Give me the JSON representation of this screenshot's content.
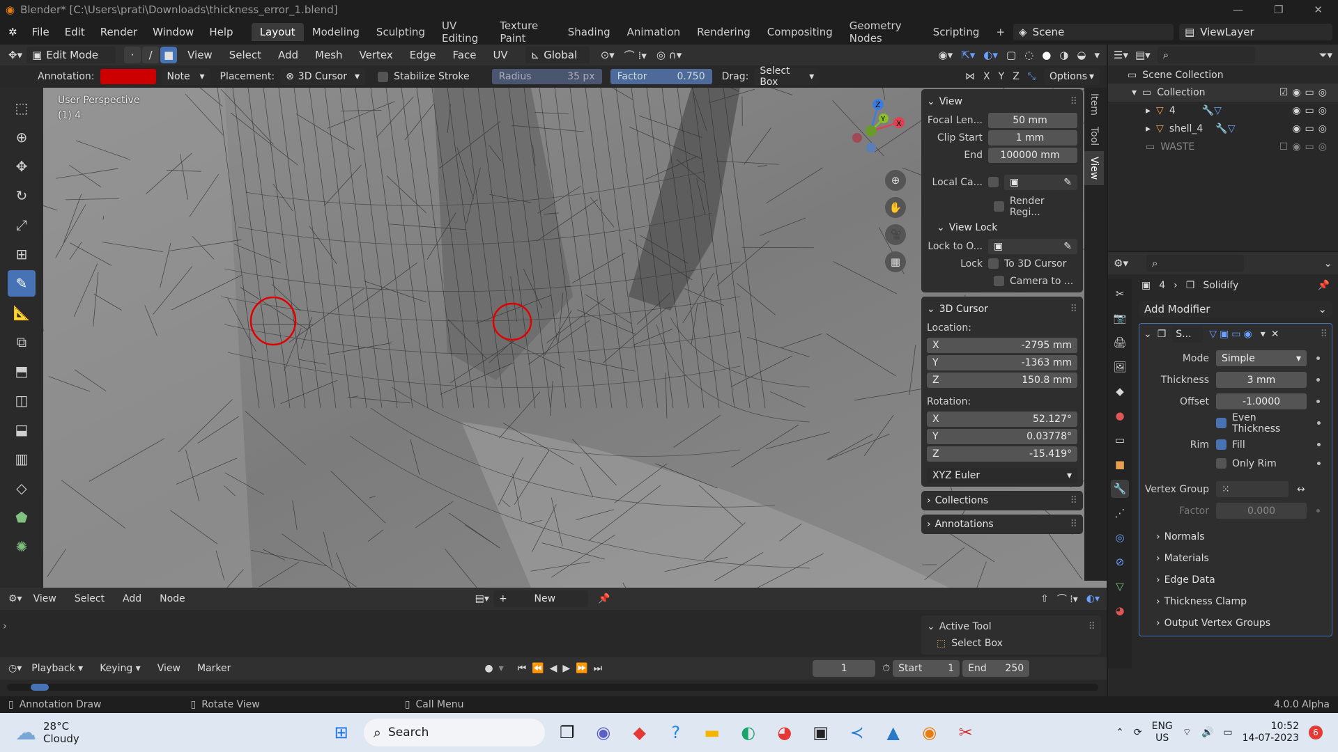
{
  "title": "Blender* [C:\\Users\\prati\\Downloads\\thickness_error_1.blend]",
  "menus": [
    "File",
    "Edit",
    "Render",
    "Window",
    "Help"
  ],
  "workspaces": [
    "Layout",
    "Modeling",
    "Sculpting",
    "UV Editing",
    "Texture Paint",
    "Shading",
    "Animation",
    "Rendering",
    "Compositing",
    "Geometry Nodes",
    "Scripting"
  ],
  "scene": "Scene",
  "view_layer": "ViewLayer",
  "header": {
    "mode": "Edit Mode",
    "menus": [
      "View",
      "Select",
      "Add",
      "Mesh",
      "Vertex",
      "Edge",
      "Face",
      "UV"
    ],
    "orientation": "Global"
  },
  "toolset": {
    "annotation_label": "Annotation:",
    "annotation_color": "#cc0000",
    "note": "Note",
    "placement_label": "Placement:",
    "placement": "3D Cursor",
    "stabilize": "Stabilize Stroke",
    "radius_label": "Radius",
    "radius": "35 px",
    "factor_label": "Factor",
    "factor": "0.750",
    "drag_label": "Drag:",
    "drag": "Select Box",
    "options": "Options",
    "axes": [
      "X",
      "Y",
      "Z"
    ]
  },
  "viewport": {
    "perspective": "User Perspective",
    "object": "(1) 4"
  },
  "npanel": {
    "view_title": "View",
    "focal_label": "Focal Len...",
    "focal": "50 mm",
    "clip_start_label": "Clip Start",
    "clip_start": "1 mm",
    "end_label": "End",
    "end": "100000 mm",
    "local_cam": "Local Ca...",
    "render_region": "Render Regi...",
    "viewlock_title": "View Lock",
    "lock_to": "Lock to O...",
    "lock_label": "Lock",
    "to_cursor": "To 3D Cursor",
    "camera_to": "Camera to ...",
    "cursor_title": "3D Cursor",
    "location_label": "Location:",
    "loc": {
      "x": "-2795 mm",
      "y": "-1363 mm",
      "z": "150.8 mm"
    },
    "rotation_label": "Rotation:",
    "rot": {
      "x": "52.127°",
      "y": "0.03778°",
      "z": "-15.419°"
    },
    "euler": "XYZ Euler",
    "collections": "Collections",
    "annotations": "Annotations"
  },
  "sidetabs": [
    "Item",
    "Tool",
    "View"
  ],
  "outliner": {
    "scene_collection": "Scene Collection",
    "collection": "Collection",
    "items": [
      "4",
      "shell_4"
    ],
    "waste": "WASTE"
  },
  "properties": {
    "object": "4",
    "modifier_path": "Solidify",
    "add_modifier": "Add Modifier",
    "mod_name": "S...",
    "mode_label": "Mode",
    "mode": "Simple",
    "thickness_label": "Thickness",
    "thickness": "3 mm",
    "offset_label": "Offset",
    "offset": "-1.0000",
    "even_thickness": "Even Thickness",
    "rim_label": "Rim",
    "fill": "Fill",
    "only_rim": "Only Rim",
    "vgroup_label": "Vertex Group",
    "factor_label": "Factor",
    "factor": "0.000",
    "subpanels": [
      "Normals",
      "Materials",
      "Edge Data",
      "Thickness Clamp",
      "Output Vertex Groups"
    ]
  },
  "node_editor": {
    "menus": [
      "View",
      "Select",
      "Add",
      "Node"
    ],
    "new": "New",
    "active_tool": "Active Tool",
    "select_box": "Select Box"
  },
  "timeline": {
    "playback": "Playback",
    "keying": "Keying",
    "view": "View",
    "marker": "Marker",
    "frame": "1",
    "start_label": "Start",
    "start": "1",
    "end_label": "End",
    "end": "250"
  },
  "status": {
    "annotation_draw": "Annotation Draw",
    "rotate_view": "Rotate View",
    "call_menu": "Call Menu",
    "version": "4.0.0 Alpha"
  },
  "taskbar": {
    "temp": "28°C",
    "weather": "Cloudy",
    "search": "Search",
    "lang1": "ENG",
    "lang2": "US",
    "time": "10:52",
    "date": "14-07-2023",
    "badge": "6"
  }
}
